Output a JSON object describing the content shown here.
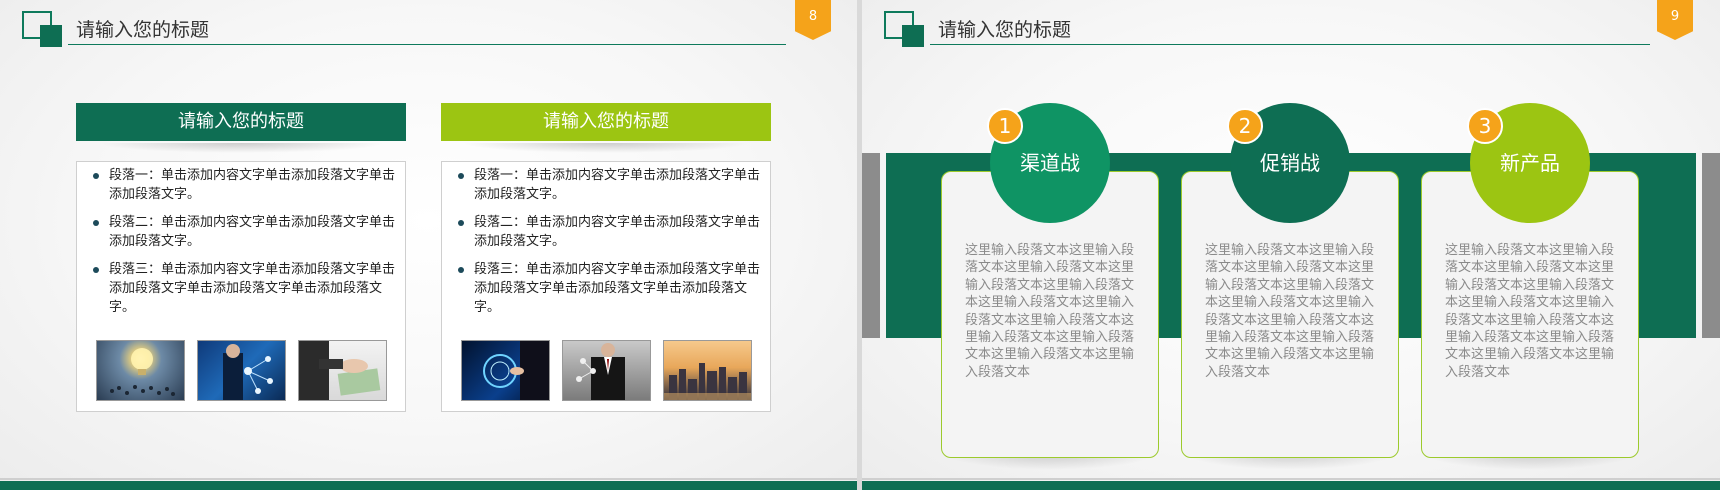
{
  "slides": [
    {
      "title": "请输入您的标题",
      "page_number": "8",
      "columns": [
        {
          "heading": "请输入您的标题",
          "bullets": [
            "段落一：单击添加内容文字单击添加段落文字单击添加段落文字。",
            "段落二：单击添加内容文字单击添加段落文字单击添加段落文字。",
            "段落三：单击添加内容文字单击添加段落文字单击添加段落文字单击添加段落文字单击添加段落文字。"
          ]
        },
        {
          "heading": "请输入您的标题",
          "bullets": [
            "段落一：单击添加内容文字单击添加段落文字单击添加段落文字。",
            "段落二：单击添加内容文字单击添加段落文字单击添加段落文字。",
            "段落三：单击添加内容文字单击添加段落文字单击添加段落文字单击添加段落文字单击添加段落文字。"
          ]
        }
      ]
    },
    {
      "title": "请输入您的标题",
      "page_number": "9",
      "cards": [
        {
          "number": "1",
          "label": "渠道战",
          "text": "这里输入段落文本这里输入段落文本这里输入段落文本这里输入段落文本这里输入段落文本这里输入段落文本这里输入段落文本这里输入段落文本这里输入段落文本这里输入段落文本这里输入段落文本这里输入段落文本"
        },
        {
          "number": "2",
          "label": "促销战",
          "text": "这里输入段落文本这里输入段落文本这里输入段落文本这里输入段落文本这里输入段落文本这里输入段落文本这里输入段落文本这里输入段落文本这里输入段落文本这里输入段落文本这里输入段落文本这里输入段落文本"
        },
        {
          "number": "3",
          "label": "新产品",
          "text": "这里输入段落文本这里输入段落文本这里输入段落文本这里输入段落文本这里输入段落文本这里输入段落文本这里输入段落文本这里输入段落文本这里输入段落文本这里输入段落文本这里输入段落文本这里输入段落文本"
        }
      ]
    }
  ],
  "colors": {
    "dark_green": "#0e6e53",
    "medium_green": "#0f9464",
    "lime_green": "#9cc512",
    "orange_accent": "#f5a31a",
    "gray_side": "#8c8c8c"
  },
  "icons": {
    "photos_left": [
      "lightbulb-crowd-photo",
      "business-network-photo",
      "handshake-money-photo"
    ],
    "photos_right": [
      "tech-touch-photo",
      "businessman-network-photo",
      "city-skyline-photo"
    ]
  }
}
